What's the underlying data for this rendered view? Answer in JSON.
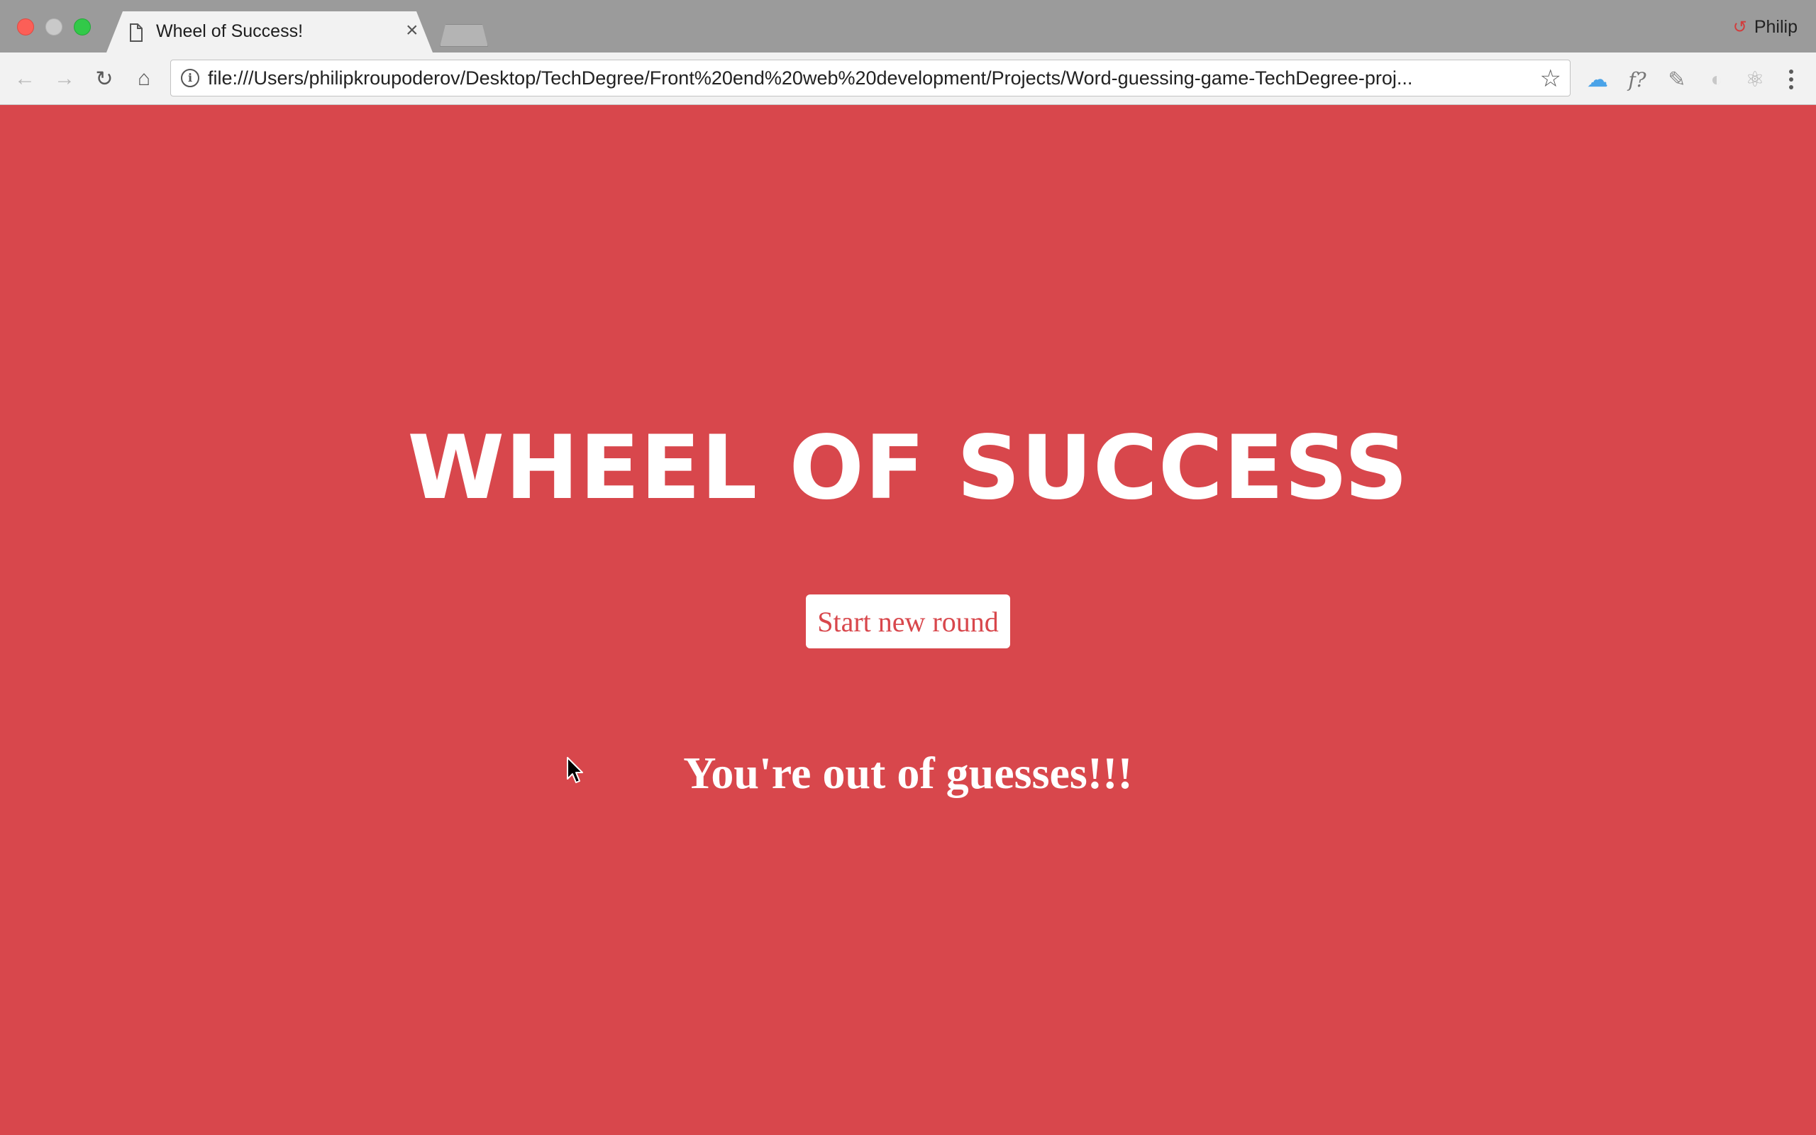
{
  "browser": {
    "tab": {
      "title": "Wheel of Success!",
      "close_glyph": "×"
    },
    "profile": {
      "name": "Philip",
      "icon": "profile-sync-icon"
    },
    "toolbar": {
      "back_glyph": "←",
      "forward_glyph": "→",
      "reload_glyph": "↻",
      "home_glyph": "⌂",
      "url": "file:///Users/philipkroupoderov/Desktop/TechDegree/Front%20end%20web%20development/Projects/Word-guessing-game-TechDegree-proj...",
      "bookmark_glyph": "☆",
      "extensions": [
        {
          "name": "cloud-icon",
          "glyph": "☁",
          "color": "#4aa3e8"
        },
        {
          "name": "function-icon",
          "glyph": "f?",
          "color": "#777777"
        },
        {
          "name": "pen-icon",
          "glyph": "✎",
          "color": "#8a8a8a"
        },
        {
          "name": "swirl-icon",
          "glyph": "◐",
          "color": "#c8c8c8"
        },
        {
          "name": "react-icon",
          "glyph": "⚛",
          "color": "#b0b0b0"
        }
      ]
    }
  },
  "page": {
    "title": "WHEEL OF SUCCESS",
    "start_button_label": "Start new round",
    "message": "You're out of guesses!!!",
    "background_color": "#d8474c",
    "text_color": "#ffffff"
  }
}
